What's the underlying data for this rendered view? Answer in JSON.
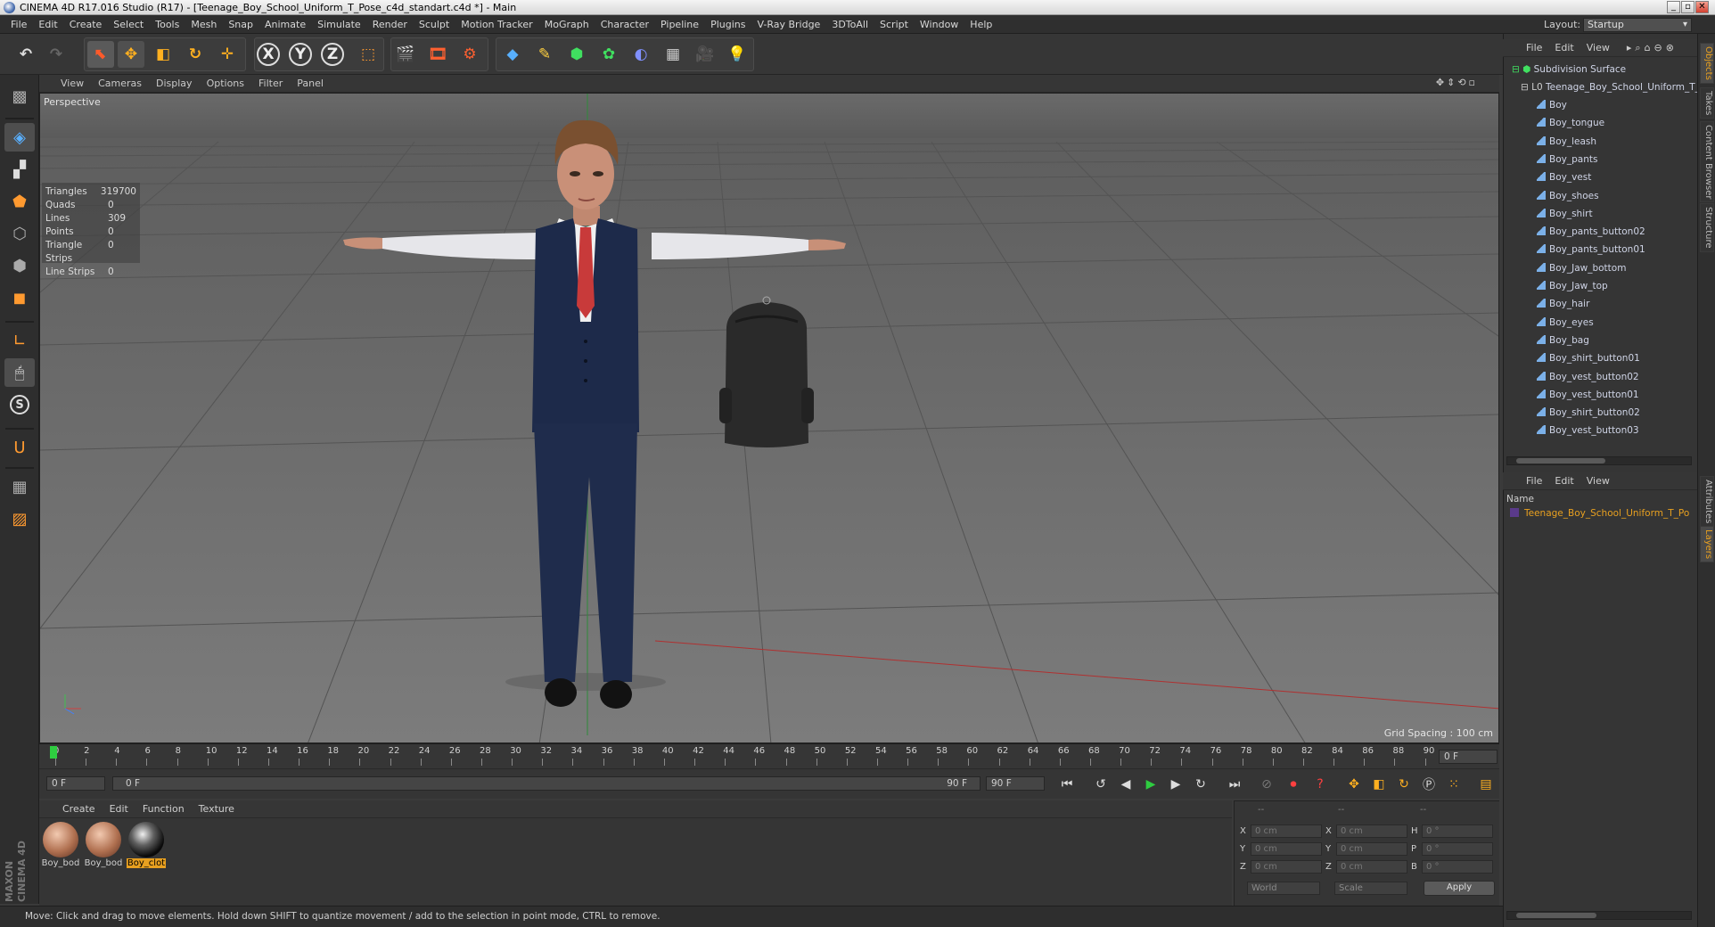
{
  "window": {
    "title": "CINEMA 4D R17.016 Studio (R17) - [Teenage_Boy_School_Uniform_T_Pose_c4d_standart.c4d *] - Main",
    "btn_min": "_",
    "btn_max": "▫",
    "btn_close": "✕"
  },
  "menu": [
    "File",
    "Edit",
    "Create",
    "Select",
    "Tools",
    "Mesh",
    "Snap",
    "Animate",
    "Simulate",
    "Render",
    "Sculpt",
    "Motion Tracker",
    "MoGraph",
    "Character",
    "Pipeline",
    "Plugins",
    "V-Ray Bridge",
    "3DToAll",
    "Script",
    "Window",
    "Help"
  ],
  "layout": {
    "label": "Layout:",
    "value": "Startup"
  },
  "toolbar": {
    "x": "X",
    "y": "Y",
    "z": "Z"
  },
  "leftbar": {
    "s_label": "S"
  },
  "viewport": {
    "menu": [
      "View",
      "Cameras",
      "Display",
      "Options",
      "Filter",
      "Panel"
    ],
    "label": "Perspective",
    "grid_spacing": "Grid Spacing : 100 cm",
    "stats": [
      {
        "k": "Triangles",
        "v": "319700"
      },
      {
        "k": "Quads",
        "v": "0"
      },
      {
        "k": "Lines",
        "v": "309"
      },
      {
        "k": "Points",
        "v": "0"
      },
      {
        "k": "Triangle Strips",
        "v": "0"
      },
      {
        "k": "Line Strips",
        "v": "0"
      }
    ]
  },
  "timeline": {
    "ticks": [
      "0",
      "2",
      "4",
      "6",
      "8",
      "10",
      "12",
      "14",
      "16",
      "18",
      "20",
      "22",
      "24",
      "26",
      "28",
      "30",
      "32",
      "34",
      "36",
      "38",
      "40",
      "42",
      "44",
      "46",
      "48",
      "50",
      "52",
      "54",
      "56",
      "58",
      "60",
      "62",
      "64",
      "66",
      "68",
      "70",
      "72",
      "74",
      "76",
      "78",
      "80",
      "82",
      "84",
      "86",
      "88",
      "90"
    ],
    "current_frame": "0 F",
    "start_frame": "0 F",
    "range_start": "0 F",
    "range_end": "90 F",
    "end_frame": "90 F"
  },
  "materials": {
    "menu": [
      "Create",
      "Edit",
      "Function",
      "Texture"
    ],
    "items": [
      {
        "label": "Boy_bod",
        "type": "skin"
      },
      {
        "label": "Boy_bod",
        "type": "skin"
      },
      {
        "label": "Boy_clot",
        "type": "dark",
        "selected": true
      }
    ]
  },
  "coords": {
    "rows": [
      {
        "a": "X",
        "av": "0 cm",
        "b": "X",
        "bv": "0 cm",
        "c": "H",
        "cv": "0 °"
      },
      {
        "a": "Y",
        "av": "0 cm",
        "b": "Y",
        "bv": "0 cm",
        "c": "P",
        "cv": "0 °"
      },
      {
        "a": "Z",
        "av": "0 cm",
        "b": "Z",
        "bv": "0 cm",
        "c": "B",
        "cv": "0 °"
      }
    ],
    "mode_world": "World",
    "mode_scale": "Scale",
    "apply": "Apply",
    "dash": "--"
  },
  "status": "Move: Click and drag to move elements. Hold down SHIFT to quantize movement / add to the selection in point mode, CTRL to remove.",
  "objects": {
    "menu": [
      "File",
      "Edit",
      "View"
    ],
    "root": "Subdivision Surface",
    "group": "Teenage_Boy_School_Uniform_T_F",
    "items": [
      "Boy",
      "Boy_tongue",
      "Boy_leash",
      "Boy_pants",
      "Boy_vest",
      "Boy_shoes",
      "Boy_shirt",
      "Boy_pants_button02",
      "Boy_pants_button01",
      "Boy_Jaw_bottom",
      "Boy_Jaw_top",
      "Boy_hair",
      "Boy_eyes",
      "Boy_bag",
      "Boy_shirt_button01",
      "Boy_vest_button02",
      "Boy_vest_button01",
      "Boy_shirt_button02",
      "Boy_vest_button03"
    ]
  },
  "layers": {
    "menu": [
      "File",
      "Edit",
      "View"
    ],
    "col_name": "Name",
    "item": "Teenage_Boy_School_Uniform_T_Po"
  },
  "side_tabs": [
    "Objects",
    "Takes",
    "Content Browser",
    "Structure",
    "Attributes",
    "Layers"
  ],
  "brand": {
    "line1": "MAXON",
    "line2": "CINEMA 4D"
  }
}
